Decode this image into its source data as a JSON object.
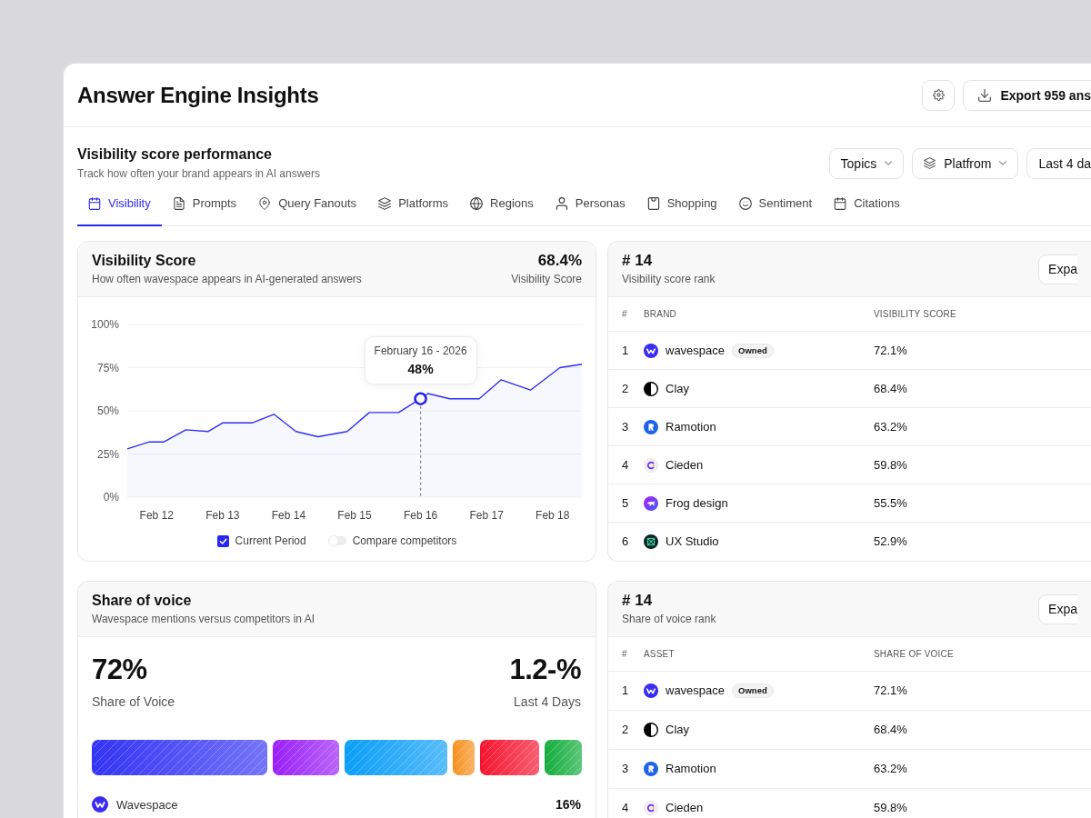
{
  "header": {
    "title": "Answer Engine Insights",
    "export_button": "Export 959 ans"
  },
  "section": {
    "title": "Visibility score performance",
    "subtitle": "Track how often your brand appears in AI answers",
    "filters": [
      {
        "kind": "dropdown",
        "label": "Topics"
      },
      {
        "kind": "icon-dropdown",
        "label": "Platfrom"
      },
      {
        "kind": "clipped",
        "label": "Last 4 da"
      }
    ]
  },
  "tabs": [
    {
      "label": "Visibility",
      "selected": true
    },
    {
      "label": "Prompts",
      "selected": false
    },
    {
      "label": "Query Fanouts",
      "selected": false
    },
    {
      "label": "Platforms",
      "selected": false
    },
    {
      "label": "Regions",
      "selected": false
    },
    {
      "label": "Personas",
      "selected": false
    },
    {
      "label": "Shopping",
      "selected": false
    },
    {
      "label": "Sentiment",
      "selected": false
    },
    {
      "label": "Citations",
      "selected": false
    }
  ],
  "visibility_card": {
    "title": "Visibility Score",
    "subtitle": "How often wavespace appears in AI-generated answers",
    "score": "68.4%",
    "score_label": "Visibility Score",
    "chart_data": {
      "type": "area",
      "grid": true,
      "categories": [
        null,
        null,
        null,
        null,
        "Feb 12",
        null,
        null,
        null,
        null,
        null,
        null,
        null,
        null,
        "Feb 13",
        null,
        null,
        null,
        null,
        null,
        null,
        null,
        null,
        "Feb 14",
        null,
        null,
        null,
        null,
        null,
        null,
        null,
        null,
        "Feb 15",
        null,
        null,
        null,
        null,
        null,
        null,
        null,
        null,
        "Feb 16",
        null,
        null,
        null,
        null,
        null,
        null,
        null,
        null,
        "Feb 17",
        null,
        null,
        null,
        null,
        null,
        null,
        null,
        null,
        "Feb 18",
        null,
        null,
        null,
        null
      ],
      "values": [
        28,
        null,
        null,
        32,
        null,
        32,
        null,
        null,
        39,
        null,
        null,
        38,
        null,
        43,
        null,
        null,
        null,
        43,
        null,
        null,
        48,
        null,
        null,
        38,
        null,
        null,
        35,
        null,
        null,
        null,
        38,
        null,
        null,
        49,
        null,
        null,
        null,
        49,
        null,
        null,
        57,
        60,
        null,
        null,
        57,
        null,
        null,
        null,
        57,
        null,
        null,
        68,
        null,
        null,
        null,
        62,
        null,
        null,
        null,
        75,
        null,
        null,
        77
      ],
      "ylim": [
        0,
        100
      ],
      "yticks": [
        {
          "value": 0,
          "label": "0%"
        },
        {
          "value": 25,
          "label": "25%"
        },
        {
          "value": 50,
          "label": "50%"
        },
        {
          "value": 75,
          "label": "75%"
        },
        {
          "value": 100,
          "label": "100%"
        }
      ],
      "annotations": [
        {
          "x": "Feb 16"
        }
      ]
    },
    "tooltip": {
      "date": "February 16 - 2026",
      "value": "48%"
    },
    "legend": [
      {
        "kind": "checkbox",
        "label": "Current Period",
        "checked": true
      },
      {
        "kind": "toggle",
        "label": "Compare competitors",
        "on": false
      }
    ]
  },
  "visibility_rank": {
    "title": "# 14",
    "subtitle": "Visibility score rank",
    "button": "Expa",
    "columns": [
      "#",
      "BRAND",
      "VISIBILITY SCORE"
    ],
    "rows": [
      {
        "rank": "1",
        "name": "wavespace",
        "badge": "Owned",
        "value": "72.1%"
      },
      {
        "rank": "2",
        "name": "Clay",
        "value": "68.4%"
      },
      {
        "rank": "3",
        "name": "Ramotion",
        "value": "63.2%"
      },
      {
        "rank": "4",
        "name": "Cieden",
        "value": "59.8%"
      },
      {
        "rank": "5",
        "name": "Frog design",
        "value": "55.5%"
      },
      {
        "rank": "6",
        "name": "UX Studio",
        "value": "52.9%"
      }
    ]
  },
  "share_of_voice": {
    "title": "Share of voice",
    "subtitle": "Wavespace mentions versus competitors in AI",
    "value": "72%",
    "value_label": "Share of Voice",
    "change": "1.2-%",
    "change_label": "Last 4 Days",
    "legend": [
      {
        "name": "Wavespace",
        "value": "16%"
      }
    ]
  },
  "voice_rank": {
    "title": "# 14",
    "subtitle": "Share of voice rank",
    "button": "Expa",
    "columns": [
      "#",
      "ASSET",
      "SHARE OF VOICE"
    ],
    "rows": [
      {
        "rank": "1",
        "name": "wavespace",
        "badge": "Owned",
        "value": "72.1%"
      },
      {
        "rank": "2",
        "name": "Clay",
        "value": "68.4%"
      },
      {
        "rank": "3",
        "name": "Ramotion",
        "value": "63.2%"
      },
      {
        "rank": "4",
        "name": "Cieden",
        "value": "59.8%"
      }
    ]
  }
}
